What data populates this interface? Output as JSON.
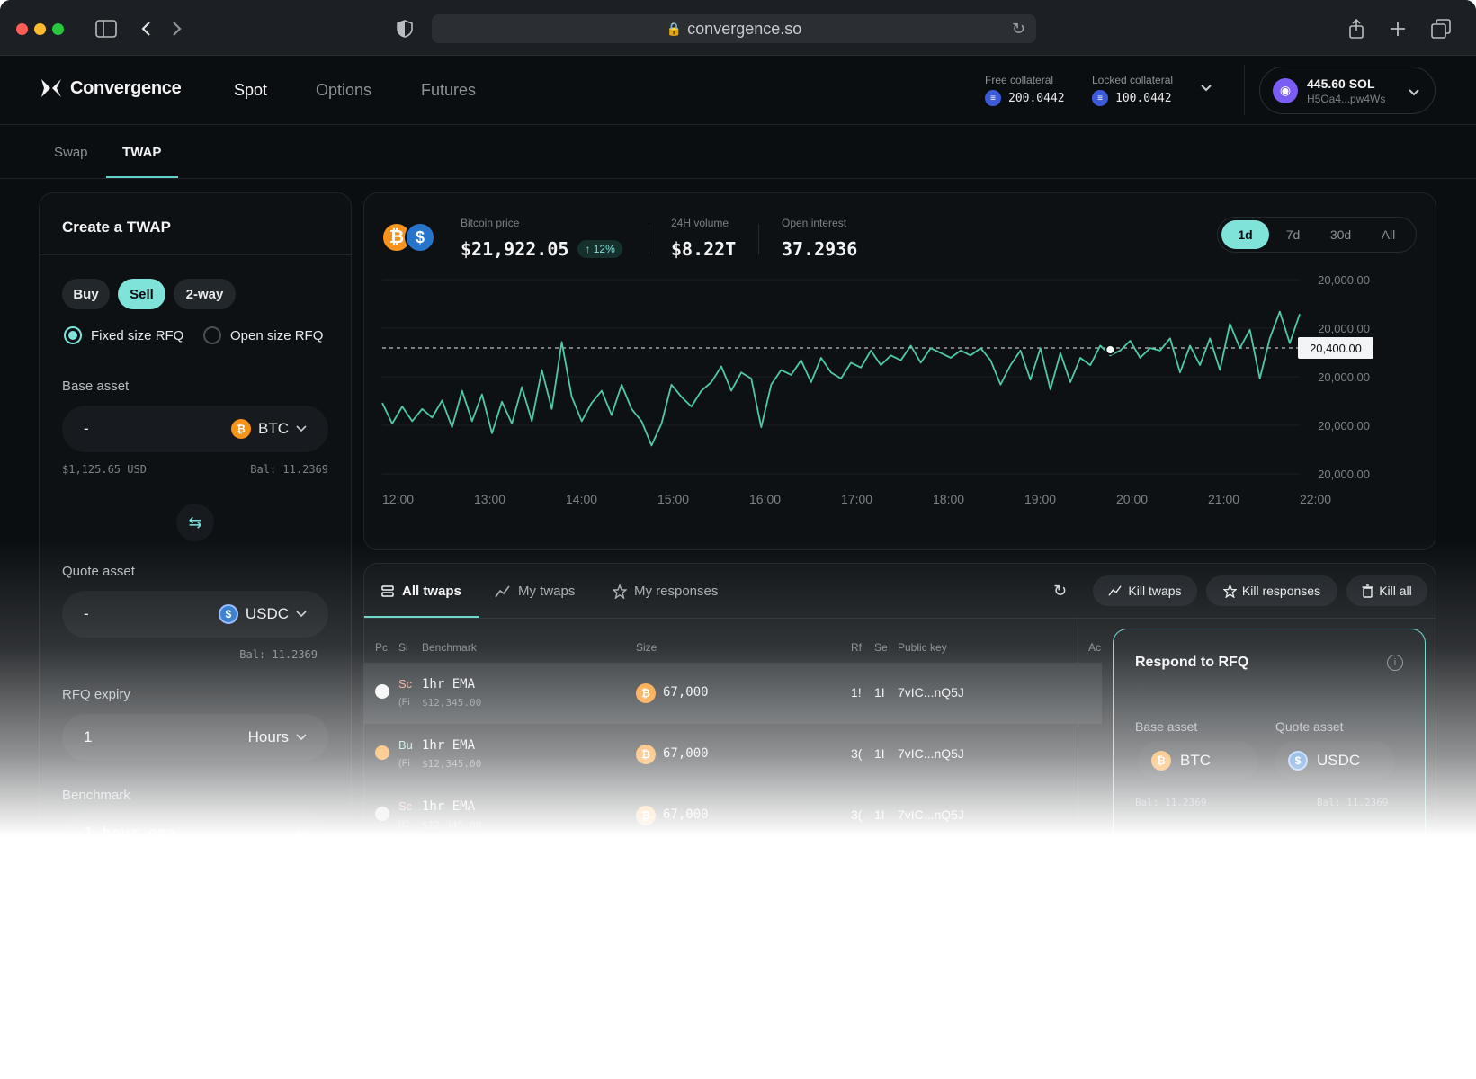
{
  "browser": {
    "url": "convergence.so"
  },
  "app": {
    "brand": "Convergence",
    "nav": [
      "Spot",
      "Options",
      "Futures"
    ],
    "active_nav": "Spot",
    "collateral": {
      "free_label": "Free collateral",
      "free_value": "200.0442",
      "locked_label": "Locked collateral",
      "locked_value": "100.0442"
    },
    "wallet": {
      "balance": "445.60 SOL",
      "address": "H5Oa4...pw4Ws"
    }
  },
  "subtabs": [
    "Swap",
    "TWAP"
  ],
  "active_subtab": "TWAP",
  "create_twap": {
    "title": "Create a TWAP",
    "sides": [
      "Buy",
      "Sell",
      "2-way"
    ],
    "active_side": "Sell",
    "rfq_types": [
      "Fixed size RFQ",
      "Open size RFQ"
    ],
    "selected_rfq_type": "Fixed size RFQ",
    "base_asset": {
      "label": "Base asset",
      "value": "-",
      "asset": "BTC",
      "usd": "$1,125.65 USD",
      "balance": "Bal: 11.2369"
    },
    "quote_asset": {
      "label": "Quote asset",
      "value": "-",
      "asset": "USDC",
      "balance": "Bal: 11.2369"
    },
    "rfq_expiry": {
      "label": "RFQ expiry",
      "value": "1",
      "unit": "Hours"
    },
    "benchmark": {
      "label": "Benchmark",
      "value": "1 hour ema"
    }
  },
  "market": {
    "price_label": "Bitcoin price",
    "price": "$21,922.05",
    "change": "↑ 12%",
    "volume_label": "24H volume",
    "volume": "$8.22T",
    "oi_label": "Open interest",
    "oi": "37.2936",
    "ranges": [
      "1d",
      "7d",
      "30d",
      "All"
    ],
    "active_range": "1d"
  },
  "chart_data": {
    "type": "line",
    "title": "",
    "x_ticks": [
      "12:00",
      "13:00",
      "14:00",
      "15:00",
      "16:00",
      "17:00",
      "18:00",
      "19:00",
      "20:00",
      "21:00",
      "22:00"
    ],
    "y_ticks": [
      "20,000.00",
      "20,000.00",
      "20,000.00",
      "20,000.00",
      "20,000.00"
    ],
    "reference_value_label": "20,400.00",
    "series": [
      {
        "values": [
          0.45,
          0.28,
          0.42,
          0.3,
          0.4,
          0.33,
          0.47,
          0.25,
          0.55,
          0.3,
          0.52,
          0.2,
          0.46,
          0.28,
          0.58,
          0.3,
          0.72,
          0.4,
          0.95,
          0.5,
          0.3,
          0.45,
          0.55,
          0.35,
          0.6,
          0.4,
          0.3,
          0.1,
          0.28,
          0.6,
          0.5,
          0.42,
          0.55,
          0.62,
          0.75,
          0.55,
          0.7,
          0.65,
          0.25,
          0.6,
          0.72,
          0.68,
          0.8,
          0.62,
          0.82,
          0.7,
          0.65,
          0.78,
          0.74,
          0.88,
          0.76,
          0.84,
          0.8,
          0.92,
          0.78,
          0.9,
          0.86,
          0.82,
          0.88,
          0.84,
          0.9,
          0.8,
          0.6,
          0.76,
          0.88,
          0.64,
          0.9,
          0.56,
          0.86,
          0.62,
          0.82,
          0.76,
          0.92,
          0.84,
          0.88,
          0.96,
          0.82,
          0.9,
          0.88,
          0.98,
          0.7,
          0.92,
          0.76,
          0.98,
          0.72,
          1.1,
          0.9,
          1.05,
          0.65,
          0.98,
          1.2,
          0.94,
          1.18
        ]
      }
    ]
  },
  "twaps": {
    "tabs": [
      "All twaps",
      "My twaps",
      "My responses"
    ],
    "active_tab": "All twaps",
    "actions": [
      "Kill twaps",
      "Kill responses",
      "Kill all"
    ],
    "columns": [
      "Pc",
      "Si",
      "Benchmark",
      "Size",
      "Rf",
      "Se",
      "Public key",
      "Ac"
    ],
    "rows": [
      {
        "side": "Sc",
        "side_sub": "(Fi",
        "benchmark": "1hr EMA",
        "benchmark_sub": "$12,345.00",
        "size": "67,000",
        "rf": "1!",
        "se": "1I",
        "key": "7vIC...nQ5J"
      },
      {
        "side": "Bu",
        "side_sub": "(Fi",
        "benchmark": "1hr EMA",
        "benchmark_sub": "$12,345.00",
        "size": "67,000",
        "rf": "3(",
        "se": "1I",
        "key": "7vIC...nQ5J"
      },
      {
        "side": "Sc",
        "side_sub": "(C",
        "benchmark": "1hr EMA",
        "benchmark_sub": "$12,345.00",
        "size": "67,000",
        "rf": "3(",
        "se": "1I",
        "key": "7vIC...nQ5J"
      }
    ]
  },
  "respond": {
    "title": "Respond to RFQ",
    "base_label": "Base asset",
    "quote_label": "Quote asset",
    "base_asset": "BTC",
    "quote_asset": "USDC",
    "base_balance": "Bal: 11.2369",
    "quote_balance": "Bal: 11.2369"
  }
}
